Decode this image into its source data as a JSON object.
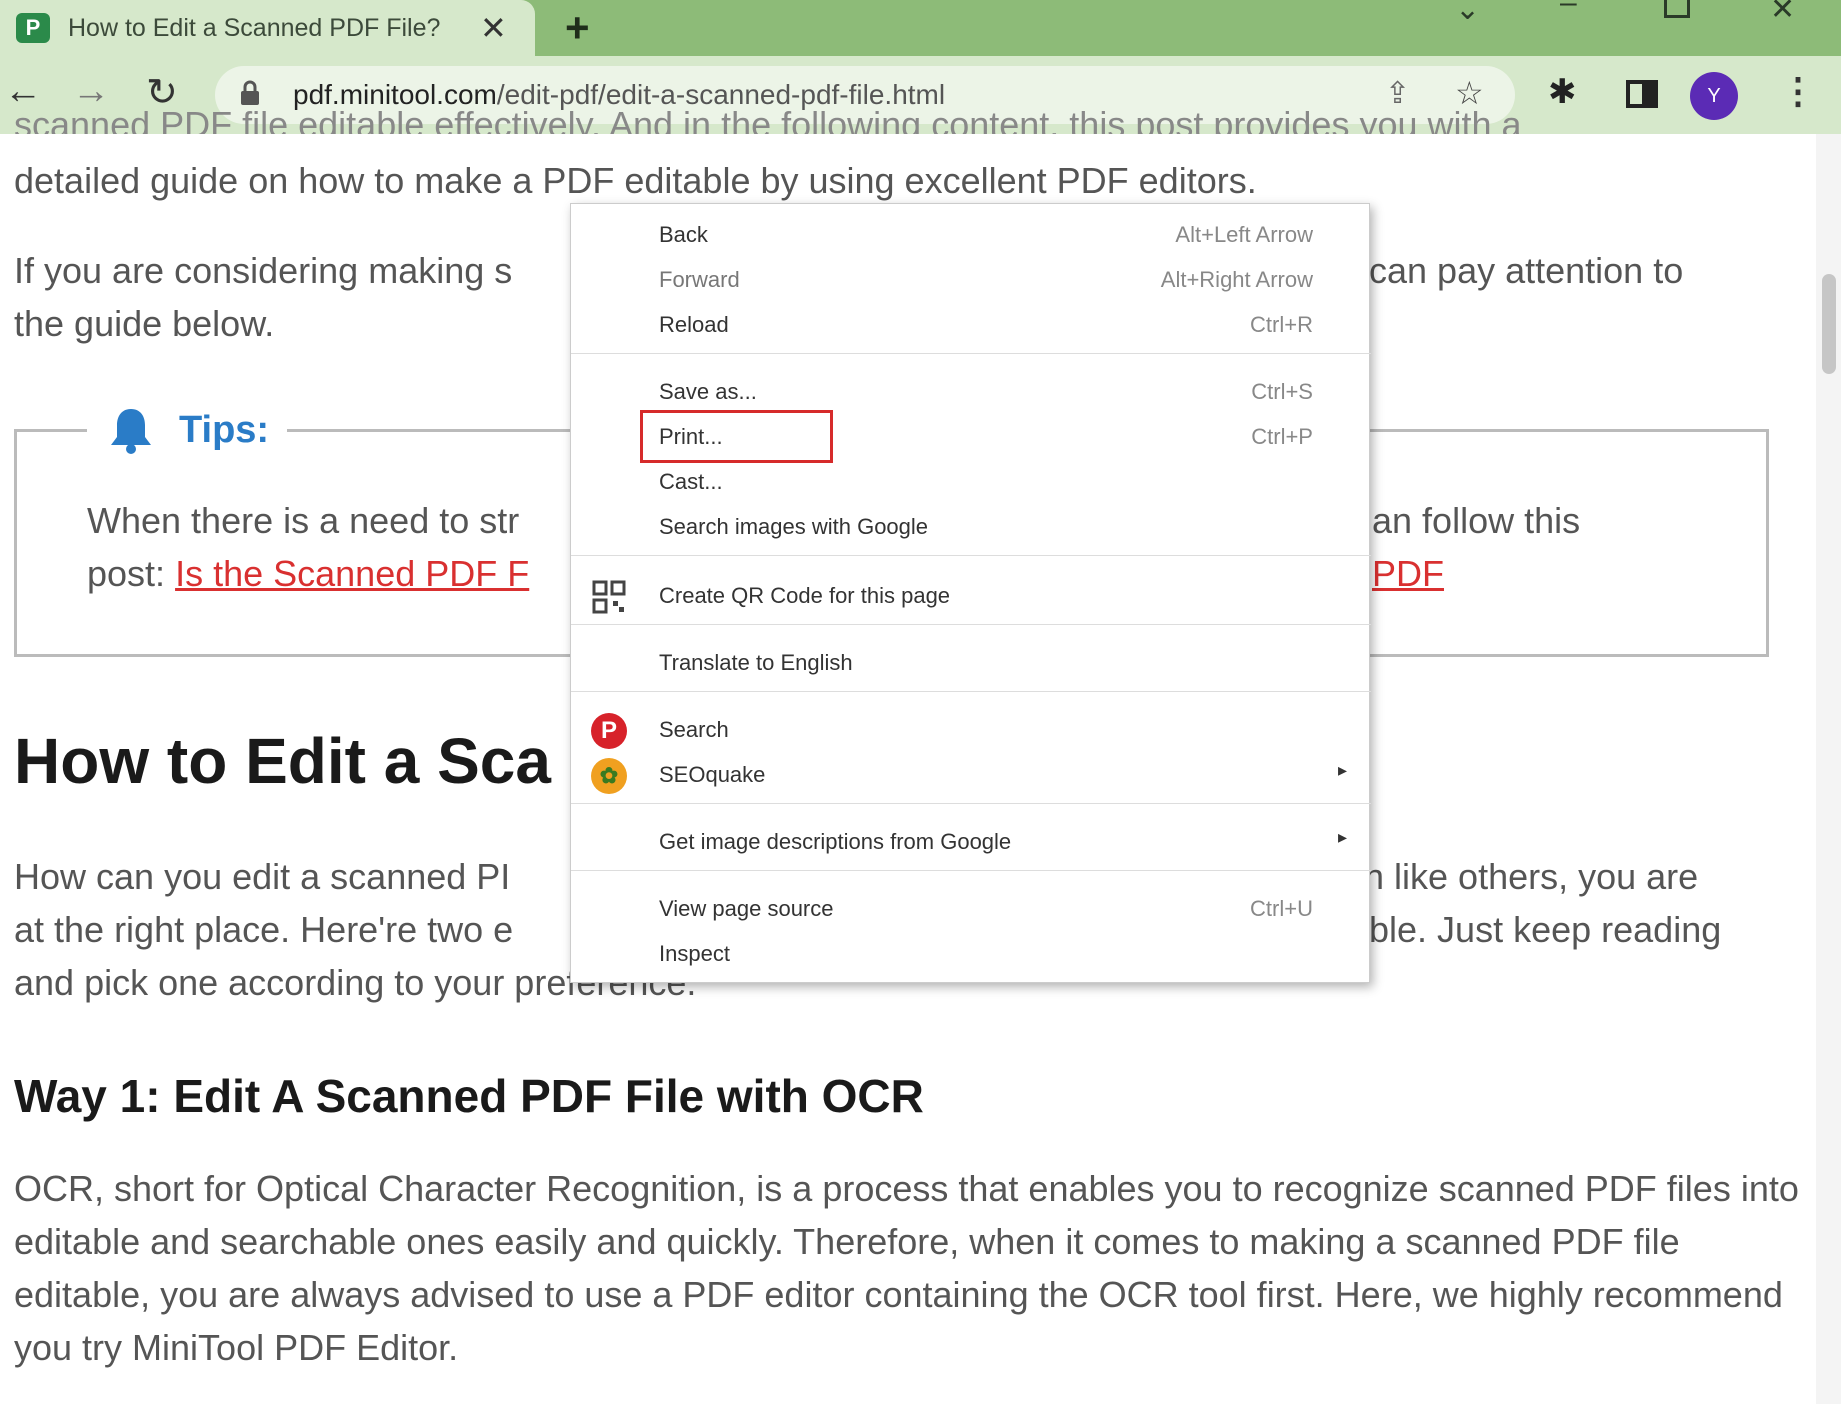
{
  "browser": {
    "tab_title": "How to Edit a Scanned PDF File?",
    "tab_favicon_letter": "P",
    "url_domain": "pdf.minitool.com",
    "url_path": "/edit-pdf/edit-a-scanned-pdf-file.html",
    "avatar_letter": "Y",
    "theme_color": "#8dbb78"
  },
  "article": {
    "top_cut": "scanned PDF file editable effectively. And in the following content, this post provides you with a",
    "intro_line": "detailed guide on how to make a PDF editable by using excellent PDF editors.",
    "intro2_left": "If you are considering making s",
    "intro2_right": "can pay attention to",
    "intro2_line2": "the guide below.",
    "tips_label": "Tips:",
    "tip_line1_left": "When there is a need to str",
    "tip_line1_right": "an follow this",
    "tip_line2_left": "post: ",
    "tip_link_left": "Is the Scanned PDF F",
    "tip_link_right": "PDF",
    "h1": "How to Edit a Sca",
    "edit_line1_left": "How can you edit a scanned PI",
    "edit_line1_right": "n like others, you are",
    "edit_line2_left": "at the right place. Here're two e",
    "edit_line2_right": "ble. Just keep reading",
    "edit_line3": "and pick one according to your preference.",
    "h2": "Way 1: Edit A Scanned PDF File with OCR",
    "ocr_para": "OCR, short for Optical Character Recognition, is a process that enables you to recognize scanned PDF files into editable and searchable ones easily and quickly. Therefore, when it comes to making a scanned PDF file editable, you are always advised to use a PDF editor containing the OCR tool first. Here, we highly recommend you try MiniTool PDF Editor."
  },
  "context_menu": {
    "back": {
      "label": "Back",
      "shortcut": "Alt+Left Arrow"
    },
    "forward": {
      "label": "Forward",
      "shortcut": "Alt+Right Arrow"
    },
    "reload": {
      "label": "Reload",
      "shortcut": "Ctrl+R"
    },
    "save_as": {
      "label": "Save as...",
      "shortcut": "Ctrl+S"
    },
    "print": {
      "label": "Print...",
      "shortcut": "Ctrl+P"
    },
    "cast": {
      "label": "Cast..."
    },
    "search_images": {
      "label": "Search images with Google"
    },
    "qr_code": {
      "label": "Create QR Code for this page"
    },
    "translate": {
      "label": "Translate to English"
    },
    "search": {
      "label": "Search"
    },
    "seoquake": {
      "label": "SEOquake"
    },
    "image_descriptions": {
      "label": "Get image descriptions from Google"
    },
    "view_source": {
      "label": "View page source",
      "shortcut": "Ctrl+U"
    },
    "inspect": {
      "label": "Inspect"
    },
    "highlight_color": "#d62a2a"
  }
}
